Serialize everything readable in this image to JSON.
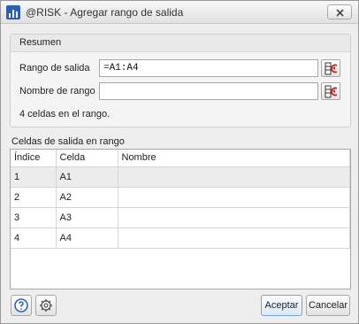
{
  "window": {
    "title": "@RISK - Agregar rango de salida",
    "app_icon": "risk-chart-icon",
    "close_icon": "close-icon"
  },
  "summary": {
    "header": "Resumen",
    "range_label": "Rango de salida",
    "range_value": "=A1:A4",
    "name_label": "Nombre de rango",
    "name_value": "",
    "count_text": "4 celdas en el rango.",
    "ref_icon": "cell-reference-picker-icon"
  },
  "cells": {
    "section_label": "Celdas de salida en rango",
    "columns": [
      "Índice",
      "Celda",
      "Nombre"
    ],
    "rows": [
      [
        "1",
        "A1",
        ""
      ],
      [
        "2",
        "A2",
        ""
      ],
      [
        "3",
        "A3",
        ""
      ],
      [
        "4",
        "A4",
        ""
      ]
    ]
  },
  "footer": {
    "help_icon": "help-icon",
    "settings_icon": "settings-icon",
    "ok_label": "Aceptar",
    "cancel_label": "Cancelar"
  },
  "colors": {
    "accent": "#2d5fb3",
    "selected_row": "#ececec",
    "ref_arrow": "#cc2222"
  }
}
